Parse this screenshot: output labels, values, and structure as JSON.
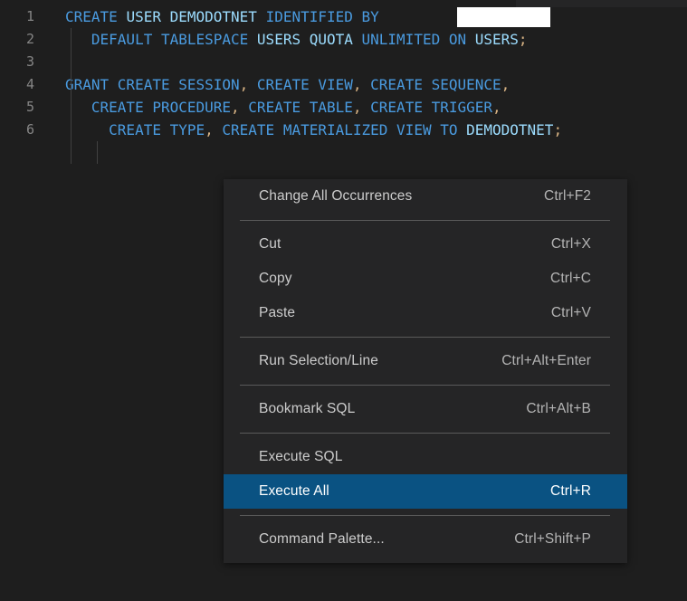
{
  "editor": {
    "background_color": "#1e1e1e",
    "keyword_color": "#4a9be0",
    "identifier_color": "#9cdcfe",
    "punctuation_color": "#d8b384",
    "line_number_color": "#858585",
    "redaction": {
      "present": true,
      "color": "#ffffff"
    },
    "lines": [
      {
        "number": "1",
        "tokens": [
          {
            "t": "CREATE ",
            "c": "kw"
          },
          {
            "t": "USER DEMODOTNET ",
            "c": "id"
          },
          {
            "t": "IDENTIFIED BY ",
            "c": "kw"
          }
        ]
      },
      {
        "number": "2",
        "tokens": [
          {
            "t": "   DEFAULT TABLESPACE ",
            "c": "kw"
          },
          {
            "t": "USERS QUOTA ",
            "c": "id"
          },
          {
            "t": "UNLIMITED ON ",
            "c": "kw"
          },
          {
            "t": "USERS",
            "c": "id"
          },
          {
            "t": ";",
            "c": "pn"
          }
        ]
      },
      {
        "number": "3",
        "tokens": []
      },
      {
        "number": "4",
        "tokens": [
          {
            "t": "GRANT CREATE SESSION",
            "c": "kw"
          },
          {
            "t": ", ",
            "c": "pn"
          },
          {
            "t": "CREATE VIEW",
            "c": "kw"
          },
          {
            "t": ", ",
            "c": "pn"
          },
          {
            "t": "CREATE SEQUENCE",
            "c": "kw"
          },
          {
            "t": ",",
            "c": "pn"
          }
        ]
      },
      {
        "number": "5",
        "tokens": [
          {
            "t": "   CREATE PROCEDURE",
            "c": "kw"
          },
          {
            "t": ", ",
            "c": "pn"
          },
          {
            "t": "CREATE TABLE",
            "c": "kw"
          },
          {
            "t": ", ",
            "c": "pn"
          },
          {
            "t": "CREATE TRIGGER",
            "c": "kw"
          },
          {
            "t": ",",
            "c": "pn"
          }
        ]
      },
      {
        "number": "6",
        "tokens": [
          {
            "t": "     CREATE TYPE",
            "c": "kw"
          },
          {
            "t": ", ",
            "c": "pn"
          },
          {
            "t": "CREATE MATERIALIZED VIEW TO ",
            "c": "kw"
          },
          {
            "t": "DEMODOTNET",
            "c": "id"
          },
          {
            "t": ";",
            "c": "pn"
          }
        ]
      }
    ]
  },
  "context_menu": {
    "background_color": "#252526",
    "selected_color": "#0a5282",
    "items": [
      {
        "label": "Change All Occurrences",
        "shortcut": "Ctrl+F2",
        "selected": false,
        "separator_after": true
      },
      {
        "label": "Cut",
        "shortcut": "Ctrl+X",
        "selected": false,
        "separator_after": false
      },
      {
        "label": "Copy",
        "shortcut": "Ctrl+C",
        "selected": false,
        "separator_after": false
      },
      {
        "label": "Paste",
        "shortcut": "Ctrl+V",
        "selected": false,
        "separator_after": true
      },
      {
        "label": "Run Selection/Line",
        "shortcut": "Ctrl+Alt+Enter",
        "selected": false,
        "separator_after": true
      },
      {
        "label": "Bookmark SQL",
        "shortcut": "Ctrl+Alt+B",
        "selected": false,
        "separator_after": true
      },
      {
        "label": "Execute SQL",
        "shortcut": "",
        "selected": false,
        "separator_after": false
      },
      {
        "label": "Execute All",
        "shortcut": "Ctrl+R",
        "selected": true,
        "separator_after": true
      },
      {
        "label": "Command Palette...",
        "shortcut": "Ctrl+Shift+P",
        "selected": false,
        "separator_after": false
      }
    ]
  }
}
